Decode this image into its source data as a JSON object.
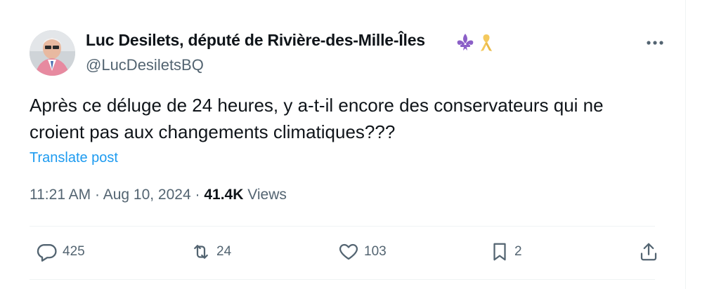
{
  "author": {
    "name": "Luc Desilets, député de Rivière-des-Mille-Îles",
    "handle": "@LucDesiletsBQ",
    "flair_icons": [
      "fleur-de-lis-icon",
      "yellow-ribbon-icon"
    ]
  },
  "post": {
    "text_line1": "Après ce déluge de 24 heures, y a-t-il encore des conservateurs qui ne",
    "text_line2": "croient pas aux changements climatiques???",
    "translate_label": "Translate post"
  },
  "meta": {
    "time": "11:21 AM",
    "separator": "·",
    "date": "Aug 10, 2024",
    "views_count": "41.4K",
    "views_label": "Views"
  },
  "actions": {
    "replies": "425",
    "reposts": "24",
    "likes": "103",
    "bookmarks": "2"
  },
  "colors": {
    "accent": "#1d9bf0",
    "secondary_text": "#536471",
    "flair_purple": "#8b5fc7",
    "ribbon_yellow": "#f4c95d"
  }
}
